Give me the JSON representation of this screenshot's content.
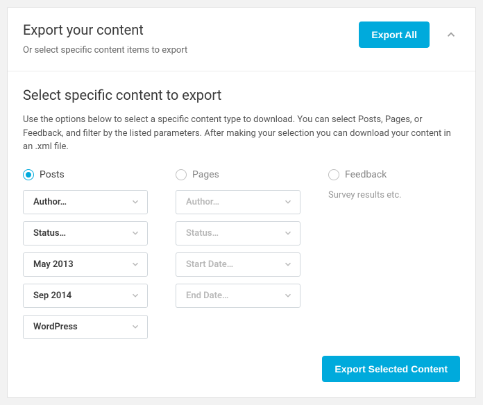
{
  "header": {
    "title": "Export your content",
    "subtitle": "Or select specific content items to export",
    "export_all_label": "Export All"
  },
  "body": {
    "title": "Select specific content to export",
    "description": "Use the options below to select a specific content type to download. You can select Posts, Pages, or Feedback, and filter by the listed parameters. After making your selection you can download your content in an .xml file.",
    "posts": {
      "label": "Posts",
      "selects": {
        "author": "Author…",
        "status": "Status…",
        "start": "May 2013",
        "end": "Sep 2014",
        "category": "WordPress"
      }
    },
    "pages": {
      "label": "Pages",
      "selects": {
        "author": "Author…",
        "status": "Status…",
        "start": "Start Date…",
        "end": "End Date…"
      }
    },
    "feedback": {
      "label": "Feedback",
      "sub": "Survey results etc."
    },
    "export_selected_label": "Export Selected Content"
  }
}
